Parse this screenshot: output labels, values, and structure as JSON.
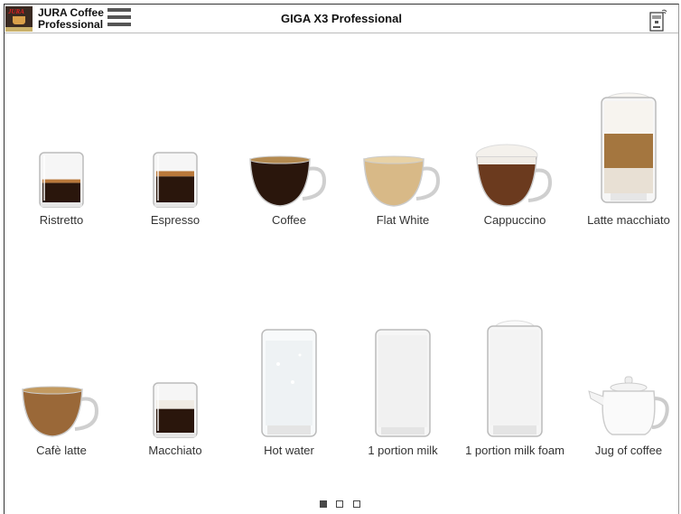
{
  "header": {
    "brand_line1": "JURA Coffee",
    "brand_line2": "Professional",
    "logo_text": "JURA",
    "title": "GIGA X3 Professional"
  },
  "products": [
    {
      "label": "Ristretto",
      "icon": "ristretto-glass-icon"
    },
    {
      "label": "Espresso",
      "icon": "espresso-glass-icon"
    },
    {
      "label": "Coffee",
      "icon": "coffee-cup-icon"
    },
    {
      "label": "Flat White",
      "icon": "flat-white-cup-icon"
    },
    {
      "label": "Cappuccino",
      "icon": "cappuccino-cup-icon"
    },
    {
      "label": "Latte macchiato",
      "icon": "latte-macchiato-glass-icon"
    },
    {
      "label": "Cafè latte",
      "icon": "cafe-latte-cup-icon"
    },
    {
      "label": "Macchiato",
      "icon": "macchiato-glass-icon"
    },
    {
      "label": "Hot water",
      "icon": "hot-water-glass-icon"
    },
    {
      "label": "1 portion milk",
      "icon": "milk-glass-icon"
    },
    {
      "label": "1 portion milk foam",
      "icon": "milk-foam-glass-icon"
    },
    {
      "label": "Jug of coffee",
      "icon": "coffee-jug-icon"
    }
  ],
  "pagination": {
    "pages": 3,
    "current": 1
  },
  "colors": {
    "coffee": "#2a160c",
    "crema": "#b9783a",
    "milk": "#f4f1ec",
    "menu": "#555555"
  }
}
